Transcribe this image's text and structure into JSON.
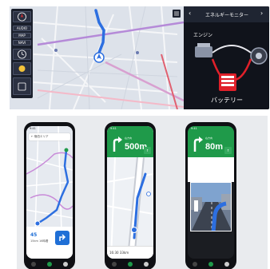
{
  "car_display": {
    "side_panel": [
      "AUDIO",
      "MAP",
      "NAVI"
    ],
    "energy_monitor": {
      "title": "エネルギーモニター",
      "prev_arrow": "‹",
      "next_arrow": "›",
      "engine_label": "エンジン",
      "battery_label": "バッテリー"
    }
  },
  "phones": {
    "phone1": {
      "search_text": "← 宿泊エリア",
      "time": "45",
      "sub_text": "15km  16時着",
      "go_icon": "arrow-icon"
    },
    "phone2": {
      "distance": "500m",
      "small_text": "右方向",
      "bottom_text": "16:30  33km"
    },
    "phone3": {
      "distance": "80m",
      "small_text": "右方向"
    }
  },
  "colors": {
    "nav_green": "#1f9a4a",
    "route_blue": "#2d6fe0",
    "battery_red": "#e0202a"
  }
}
